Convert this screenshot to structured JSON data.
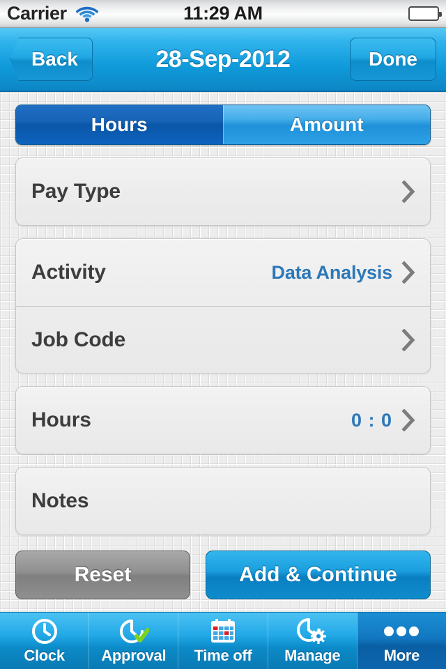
{
  "status_bar": {
    "carrier": "Carrier",
    "wifi_icon": "wifi-icon",
    "time": "11:29 AM",
    "battery_icon": "battery-full-icon"
  },
  "nav_bar": {
    "back_label": "Back",
    "title": "28-Sep-2012",
    "done_label": "Done"
  },
  "segmented_control": {
    "segments": [
      {
        "label": "Hours",
        "selected": true
      },
      {
        "label": "Amount",
        "selected": false
      }
    ]
  },
  "form": {
    "rows": [
      {
        "label": "Pay Type",
        "value": "",
        "chevron": true
      },
      {
        "label": "Activity",
        "value": "Data Analysis",
        "chevron": true
      },
      {
        "label": "Job Code",
        "value": "",
        "chevron": true
      },
      {
        "label": "Hours",
        "value": "0 : 0",
        "chevron": true
      },
      {
        "label": "Notes",
        "value": "",
        "chevron": false
      }
    ]
  },
  "actions": {
    "reset_label": "Reset",
    "add_label": "Add & Continue"
  },
  "tab_bar": {
    "tabs": [
      {
        "label": "Clock",
        "icon": "clock-icon",
        "active": false
      },
      {
        "label": "Approval",
        "icon": "clock-check-icon",
        "active": false
      },
      {
        "label": "Time off",
        "icon": "calendar-icon",
        "active": false
      },
      {
        "label": "Manage",
        "icon": "clock-gear-icon",
        "active": false
      },
      {
        "label": "More",
        "icon": "ellipsis-icon",
        "active": true
      }
    ]
  },
  "colors": {
    "nav_blue": "#0f9ada",
    "segment_selected": "#0a56a8",
    "value_blue": "#2d78b8",
    "label_gray": "#3d3d3d",
    "reset_gray": "#8f8f8f",
    "battery_green": "#86dd22",
    "calendar_red": "#d6212b",
    "check_green": "#7ed321"
  }
}
